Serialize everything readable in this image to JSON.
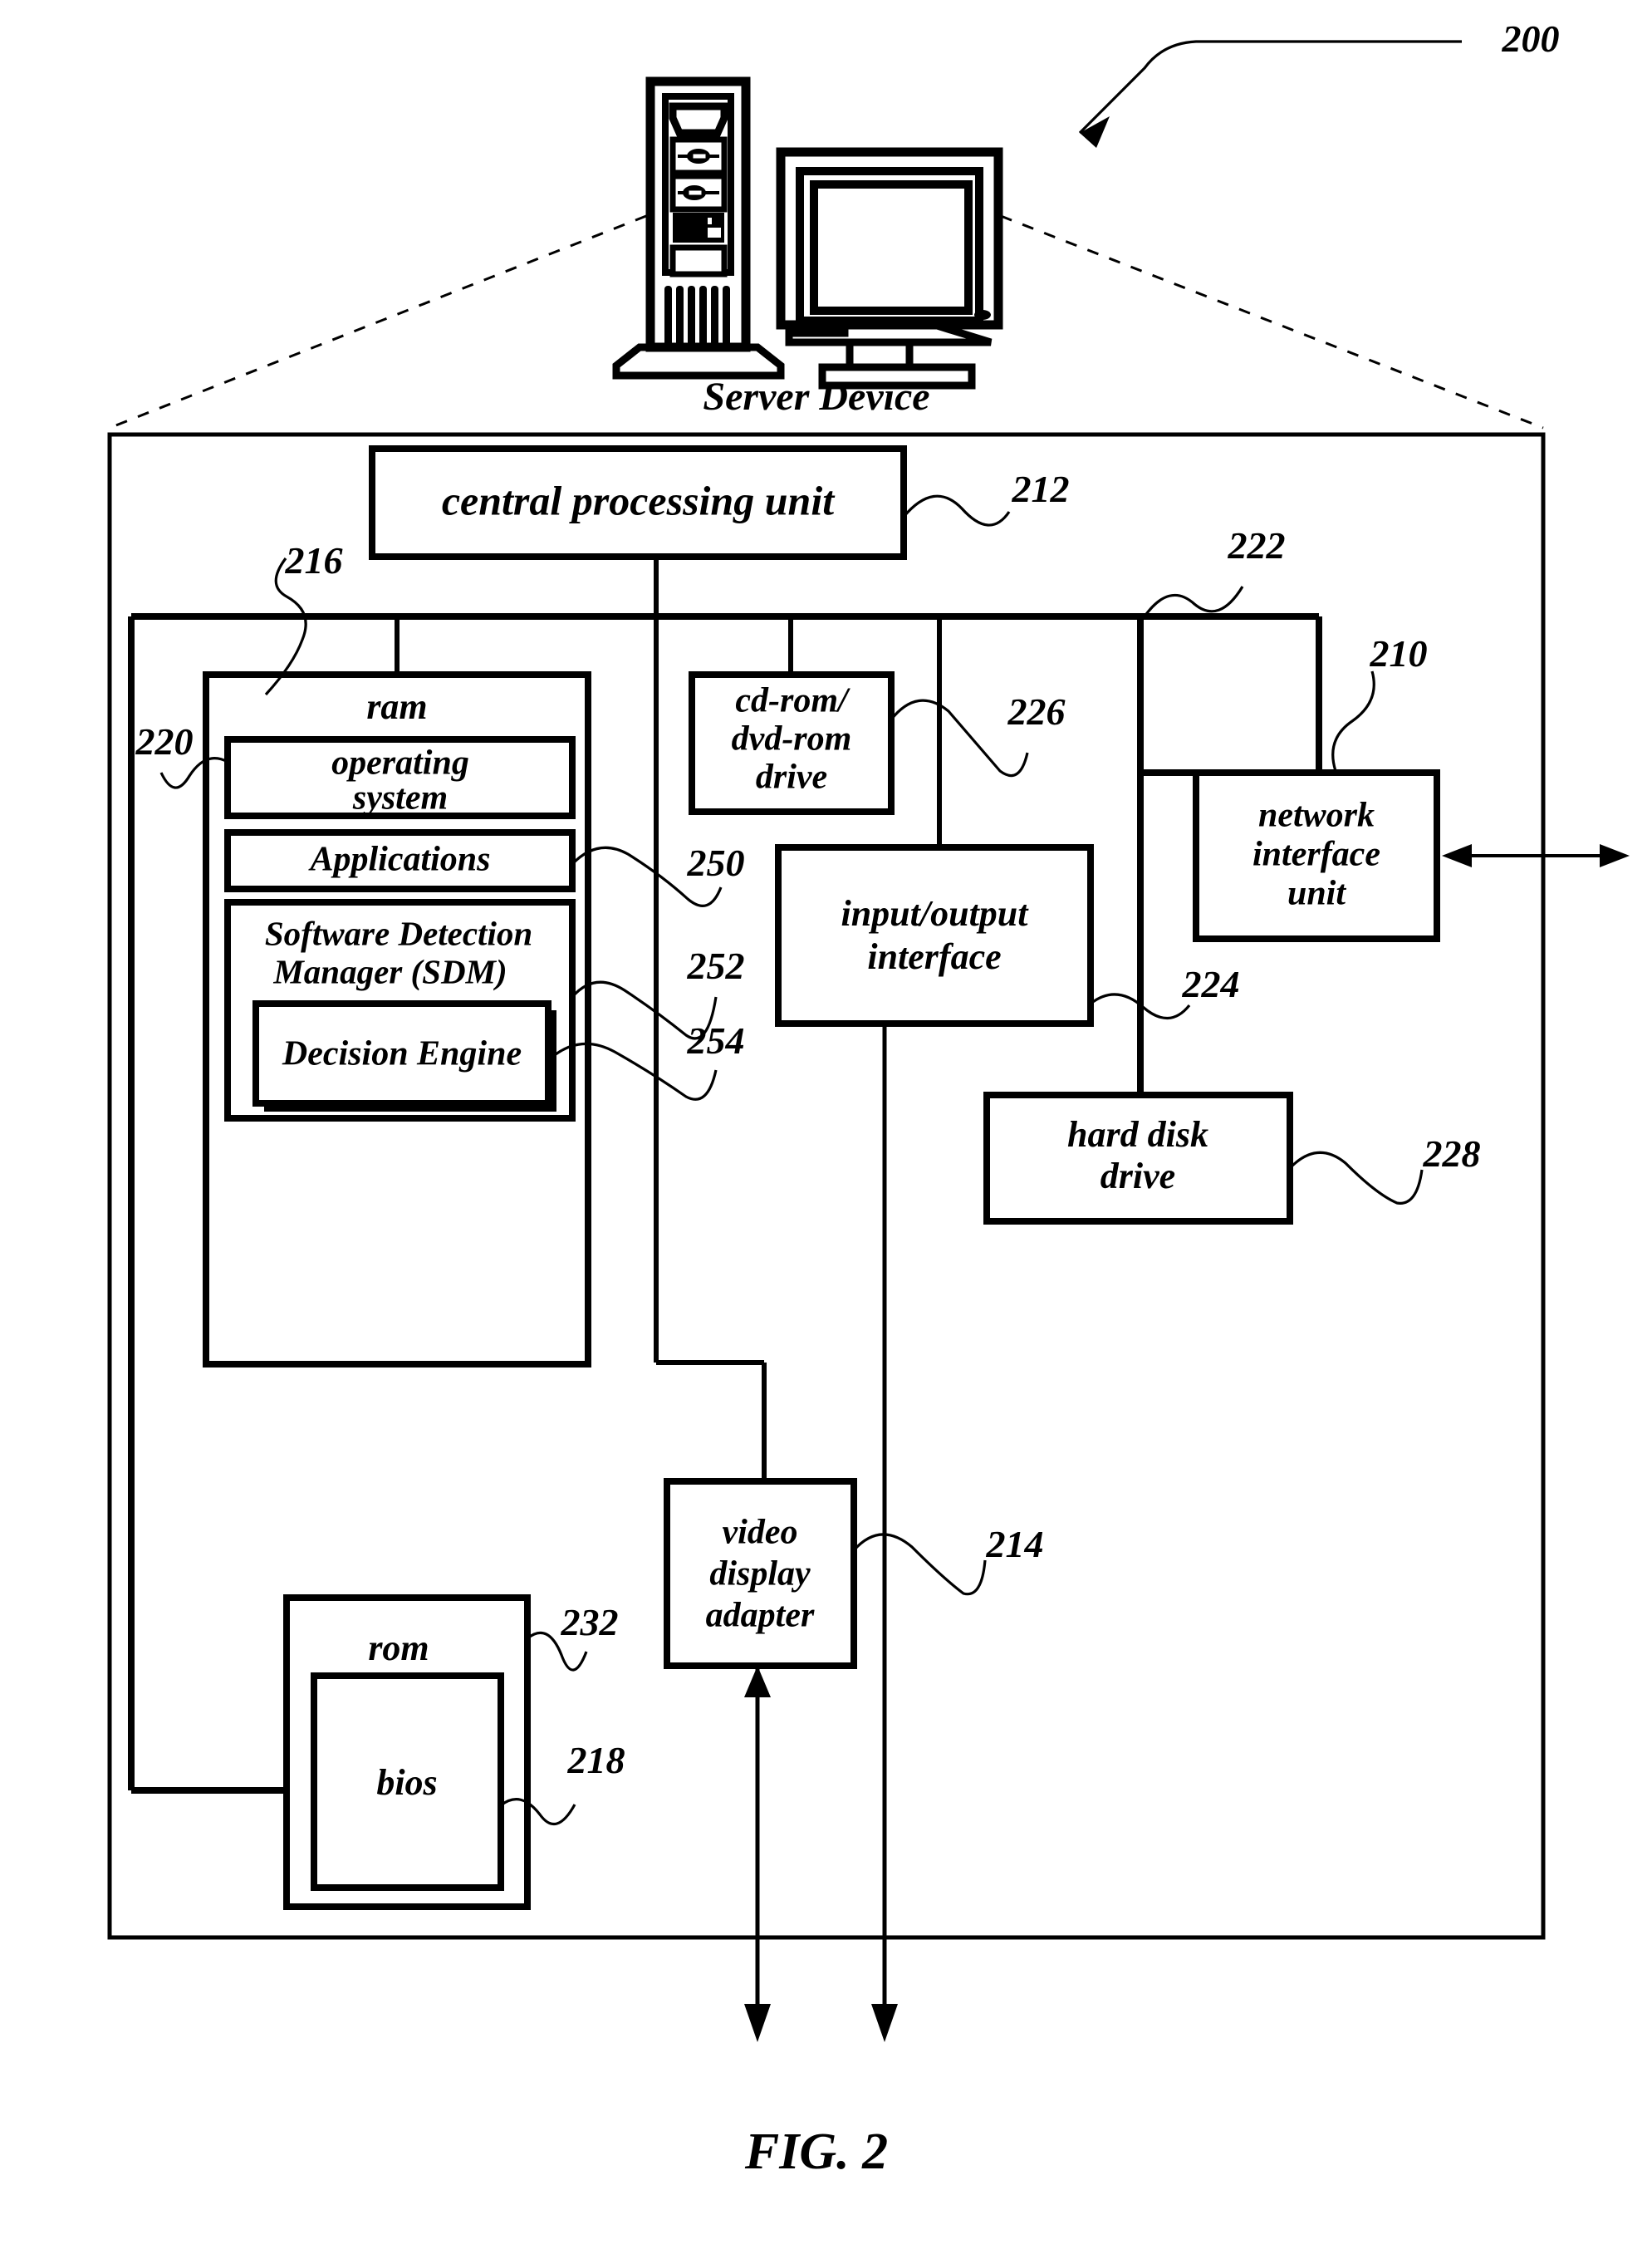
{
  "figure": {
    "caption": "FIG. 2",
    "system_ref": "200",
    "device_caption": "Server Device"
  },
  "blocks": {
    "cpu": {
      "label": "central processing unit",
      "ref": "212"
    },
    "ram": {
      "label": "ram",
      "ref": "216"
    },
    "os": {
      "label_line1": "operating",
      "label_line2": "system",
      "ref": "220"
    },
    "applications": {
      "label": "Applications",
      "ref": "250"
    },
    "sdm": {
      "label_line1": "Software Detection",
      "label_line2": "Manager (SDM)",
      "ref": "252"
    },
    "decision_engine": {
      "label": "Decision Engine",
      "ref": "254"
    },
    "cdrom": {
      "label_line1": "cd-rom/",
      "label_line2": "dvd-rom",
      "label_line3": "drive",
      "ref": "226"
    },
    "io": {
      "label_line1": "input/output",
      "label_line2": "interface"
    },
    "network": {
      "label_line1": "network",
      "label_line2": "interface",
      "label_line3": "unit",
      "ref": "210"
    },
    "hdd": {
      "label_line1": "hard disk",
      "label_line2": "drive",
      "ref": "228"
    },
    "video": {
      "label_line1": "video",
      "label_line2": "display",
      "label_line3": "adapter",
      "ref": "214"
    },
    "rom": {
      "label": "rom",
      "ref": "232"
    },
    "bios": {
      "label": "bios",
      "ref": "218"
    },
    "bus": {
      "ref": "222"
    },
    "io_bus": {
      "ref": "224"
    }
  },
  "icons": {
    "server_tower": "server-tower-icon",
    "crt_monitor": "crt-monitor-icon"
  },
  "colors": {
    "ink": "#000000",
    "paper": "#ffffff"
  }
}
